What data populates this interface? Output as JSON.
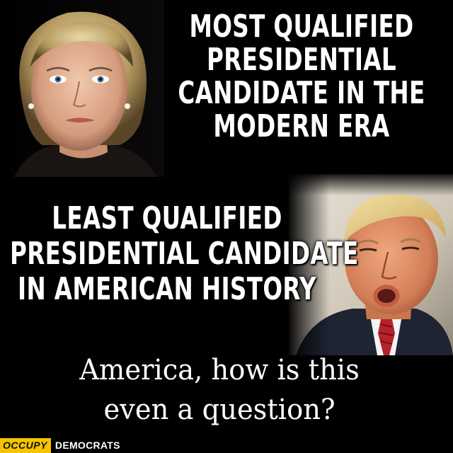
{
  "captions": {
    "top": [
      "MOST QUALIFIED",
      "PRESIDENTIAL",
      "CANDIDATE IN THE",
      "MODERN ERA"
    ],
    "middle": [
      "LEAST QUALIFIED",
      "PRESIDENTIAL CANDIDATE",
      "IN AMERICAN HISTORY"
    ],
    "question": [
      "America, how is this",
      "even a question?"
    ]
  },
  "logo": {
    "occupy": "OCCUPY",
    "democrats": "DEMOCRATS"
  },
  "colors": {
    "background": "#000000",
    "text": "#ffffff",
    "logo_accent": "#f5c400"
  }
}
